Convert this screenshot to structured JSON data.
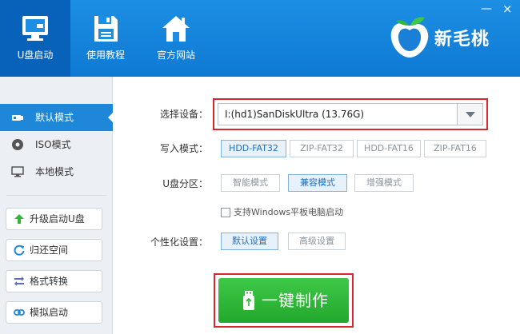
{
  "window": {
    "minimize_glyph": "—",
    "close_glyph": "×"
  },
  "nav": {
    "items": [
      {
        "label": "U盘启动",
        "icon": "monitor-icon",
        "active": true
      },
      {
        "label": "使用教程",
        "icon": "floppy-disk-icon",
        "active": false
      },
      {
        "label": "官方网站",
        "icon": "home-icon",
        "active": false
      }
    ]
  },
  "brand": {
    "name": "新毛桃",
    "icon": "peach-logo-icon"
  },
  "sidebar": {
    "modes": [
      {
        "label": "默认模式",
        "icon": "usb-drive-icon",
        "active": true
      },
      {
        "label": "ISO模式",
        "icon": "disc-icon",
        "active": false
      },
      {
        "label": "本地模式",
        "icon": "monitor-icon",
        "active": false
      }
    ],
    "tools": [
      {
        "label": "升级启动U盘",
        "icon": "upgrade-arrow-icon"
      },
      {
        "label": "归还空间",
        "icon": "restore-icon"
      },
      {
        "label": "格式转换",
        "icon": "convert-icon"
      },
      {
        "label": "模拟启动",
        "icon": "link-icon"
      }
    ]
  },
  "form": {
    "device_label": "选择设备：",
    "device_value": "I:(hd1)SanDiskUltra (13.76G)",
    "write_mode_label": "写入模式：",
    "write_modes": [
      {
        "label": "HDD-FAT32",
        "selected": true
      },
      {
        "label": "ZIP-FAT32",
        "selected": false
      },
      {
        "label": "HDD-FAT16",
        "selected": false
      },
      {
        "label": "ZIP-FAT16",
        "selected": false
      }
    ],
    "partition_label": "U盘分区：",
    "partitions": [
      {
        "label": "智能模式",
        "selected": false
      },
      {
        "label": "兼容模式",
        "selected": true
      },
      {
        "label": "增强模式",
        "selected": false
      }
    ],
    "windows_tablet_label": "支持Windows平板电脑启动",
    "windows_tablet_checked": false,
    "personalize_label": "个性化设置：",
    "personalize_options": [
      {
        "label": "默认设置",
        "selected": true
      },
      {
        "label": "高级设置",
        "selected": false
      }
    ],
    "one_click_label": "一键制作"
  },
  "colors": {
    "header": "#1587dd",
    "nav_active": "#0962b9",
    "sidebar_active": "#1f87d8",
    "go_button": "#2fb838",
    "highlight": "#d9262c"
  }
}
